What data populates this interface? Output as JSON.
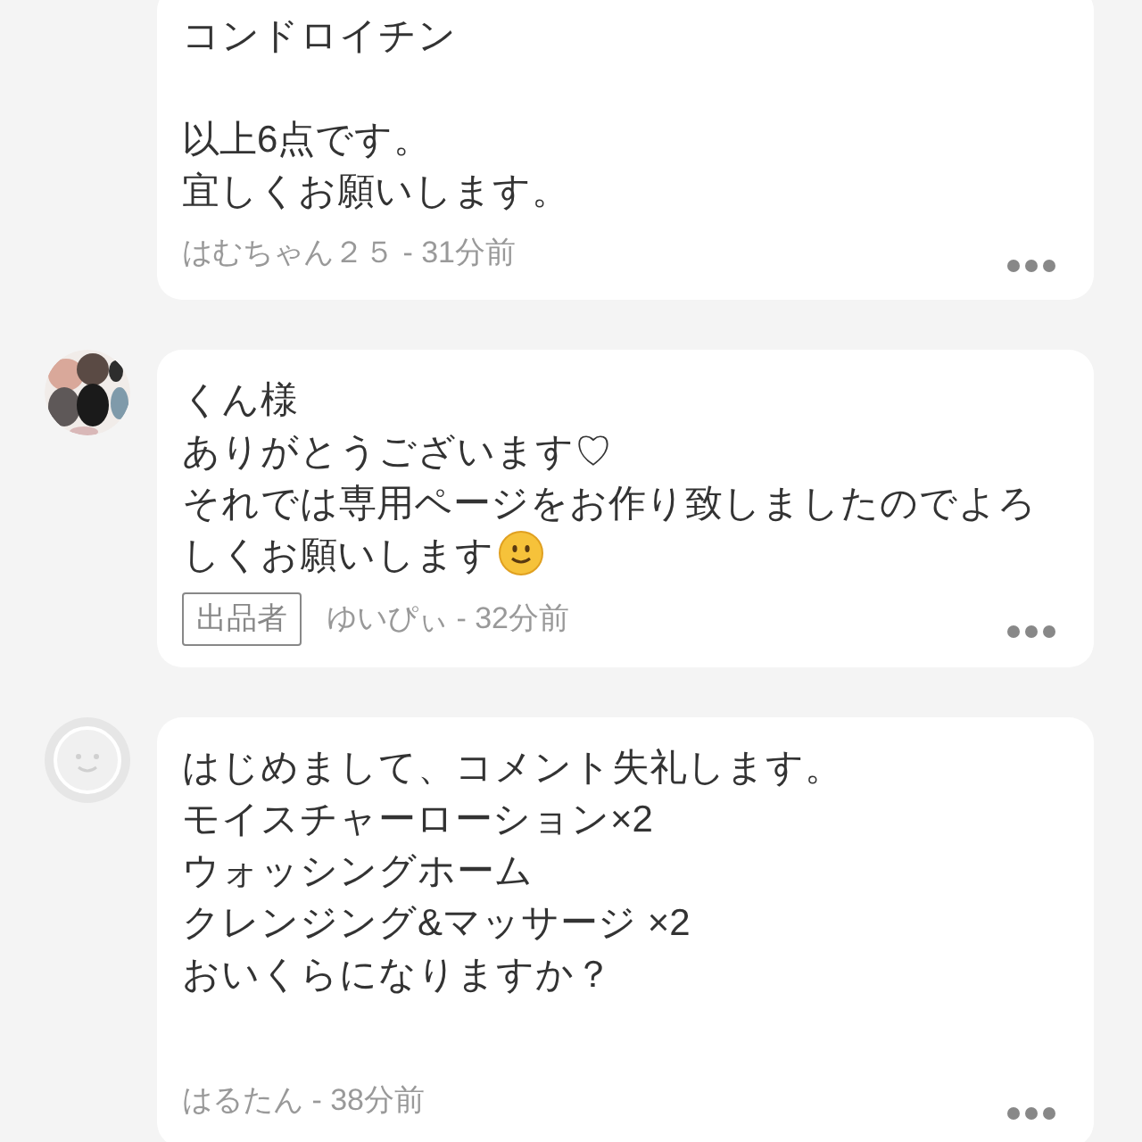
{
  "comments": [
    {
      "avatar": {
        "kind": "none"
      },
      "paragraphs": [
        [
          "コンドロイチン"
        ],
        [
          "以上6点です。",
          "宜しくお願いします。"
        ]
      ],
      "emoji": false,
      "meta": "はむちゃん２５ - 31分前"
    },
    {
      "avatar": {
        "kind": "picture"
      },
      "paragraphs": [
        [
          "くん様",
          "ありがとうございます♡",
          "それでは専用ページをお作り致しましたのでよろしくお願いします"
        ]
      ],
      "emoji": true,
      "badge": "出品者",
      "meta": "ゆいぴぃ - 32分前"
    },
    {
      "avatar": {
        "kind": "default"
      },
      "paragraphs": [
        [
          "はじめまして、コメント失礼します。",
          "モイスチャーローション×2",
          "ウォッシングホーム",
          "クレンジング&マッサージ ×2",
          "おいくらになりますか？"
        ]
      ],
      "emoji": false,
      "meta": "はるたん - 38分前"
    }
  ]
}
